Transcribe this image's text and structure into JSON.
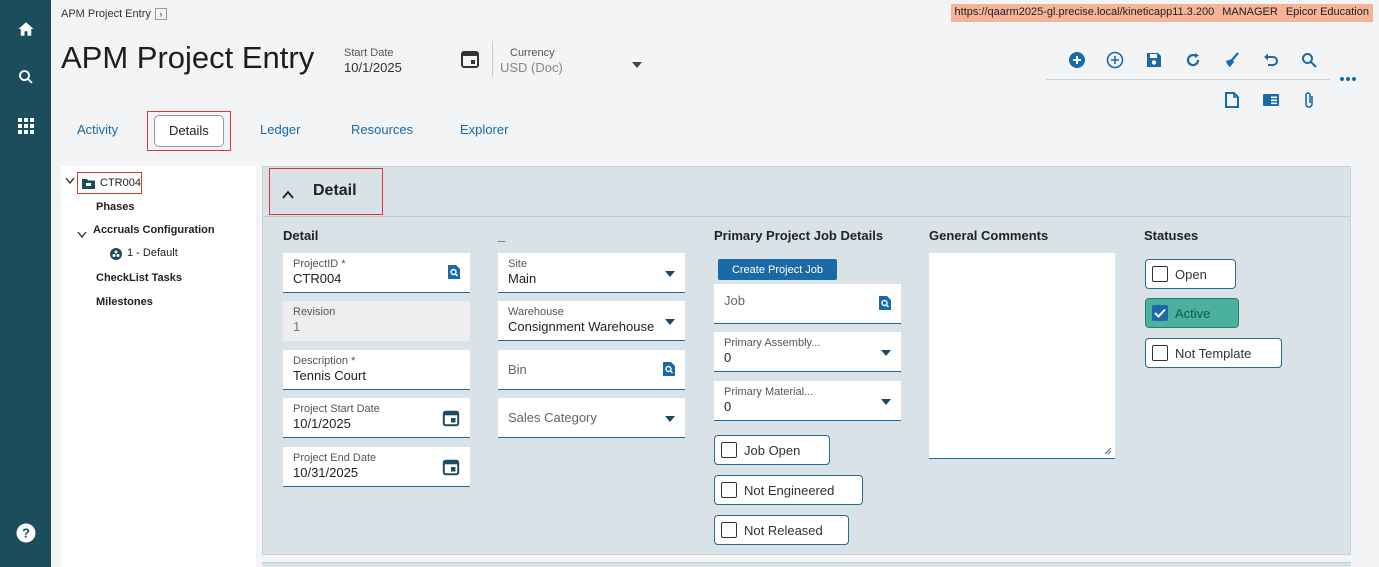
{
  "breadcrumb": {
    "label": "APM Project Entry"
  },
  "env": {
    "url": "https://qaarm2025-gl.precise.local/kineticapp11.3.200",
    "user": "MANAGER",
    "company": "Epicor Education"
  },
  "header": {
    "title": "APM Project Entry",
    "start_date_label": "Start Date",
    "start_date_value": "10/1/2025",
    "currency_label": "Currency",
    "currency_value": "USD (Doc)"
  },
  "tabs": [
    {
      "label": "Activity"
    },
    {
      "label": "Details"
    },
    {
      "label": "Ledger"
    },
    {
      "label": "Resources"
    },
    {
      "label": "Explorer"
    }
  ],
  "tree": {
    "root": "CTR004",
    "phases": "Phases",
    "accruals": "Accruals Configuration",
    "accruals_child": "1 - Default",
    "checklist": "CheckList Tasks",
    "milestones": "Milestones"
  },
  "panel": {
    "title": "Detail",
    "sections": {
      "detail": "Detail",
      "second": "_",
      "primary_job": "Primary Project Job Details",
      "comments": "General Comments",
      "statuses": "Statuses"
    },
    "fields": {
      "project_id": {
        "label": "ProjectID *",
        "value": "CTR004"
      },
      "revision": {
        "label": "Revision",
        "value": "1"
      },
      "description": {
        "label": "Description *",
        "value": "Tennis Court"
      },
      "start_date": {
        "label": "Project Start Date",
        "value": "10/1/2025"
      },
      "end_date": {
        "label": "Project End Date",
        "value": "10/31/2025"
      },
      "site": {
        "label": "Site",
        "value": "Main"
      },
      "warehouse": {
        "label": "Warehouse",
        "value": "Consignment Warehouse"
      },
      "bin": {
        "placeholder": "Bin"
      },
      "sales_category": {
        "placeholder": "Sales Category"
      },
      "job": {
        "placeholder": "Job"
      },
      "primary_assembly": {
        "label": "Primary Assembly...",
        "value": "0"
      },
      "primary_material": {
        "label": "Primary Material...",
        "value": "0"
      }
    },
    "create_job_label": "Create Project Job",
    "job_checks": [
      {
        "label": "Job Open",
        "checked": false
      },
      {
        "label": "Not Engineered",
        "checked": false
      },
      {
        "label": "Not Released",
        "checked": false
      }
    ],
    "statuses": [
      {
        "label": "Open",
        "checked": false
      },
      {
        "label": "Active",
        "checked": true
      },
      {
        "label": "Not Template",
        "checked": false
      }
    ]
  },
  "colors": {
    "accent": "#1a6aa8",
    "rail": "#1b4d5c",
    "panel": "#d9e2e6",
    "active_status": "#4bb19e",
    "highlight": "#d9383a"
  }
}
